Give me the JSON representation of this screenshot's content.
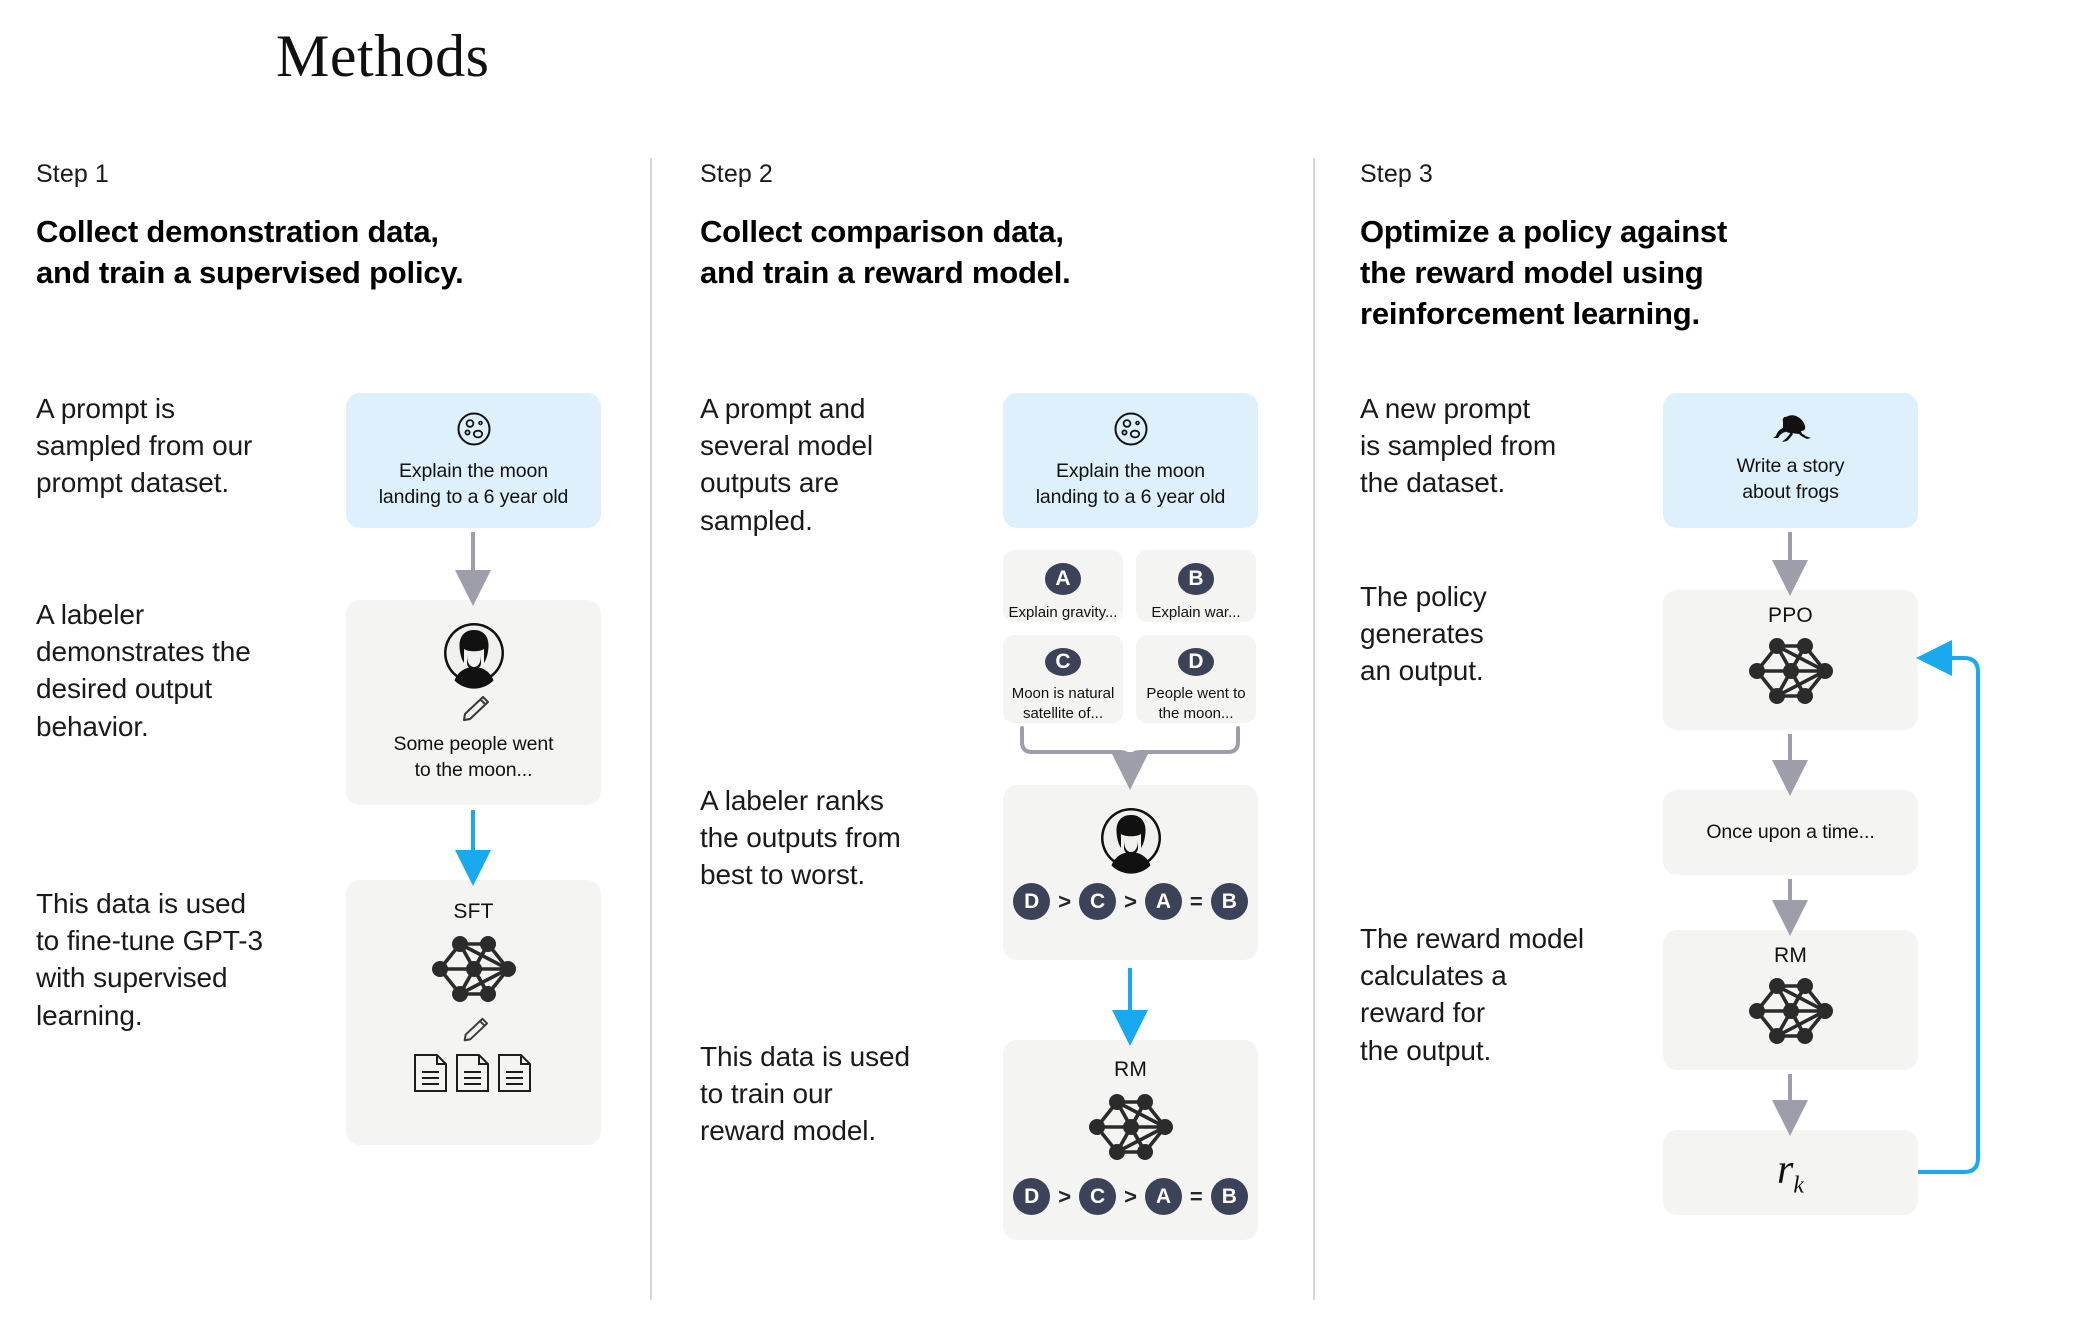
{
  "title": "Methods",
  "colors": {
    "prompt_box_bg": "#ddf0fb",
    "neutral_box_bg": "#f4f4f2",
    "gray_arrow": "#9e9eaa",
    "blue_arrow": "#19a9ef",
    "badge_bg": "#3c4257",
    "divider": "#d6d6d6"
  },
  "columns": [
    {
      "step_label": "Step 1",
      "step_title": "Collect demonstration data,\nand train a supervised policy.",
      "captions": [
        "A prompt is\nsampled from our\nprompt dataset.",
        "A labeler\ndemonstrates the\ndesired output\nbehavior.",
        "This data is used\nto fine-tune GPT-3\nwith supervised\nlearning."
      ],
      "nodes": {
        "prompt": {
          "icon": "moon-icon",
          "text": "Explain the moon\nlanding to a 6 year old"
        },
        "labeler": {
          "icon": "labeler-avatar-icon",
          "sub_icon": "pencil-icon",
          "text": "Some people went\nto the moon..."
        },
        "model": {
          "title": "SFT",
          "icon": "neural-network-icon",
          "sub_icon": "pencil-icon",
          "docs_icon": "documents-icon"
        }
      }
    },
    {
      "step_label": "Step 2",
      "step_title": "Collect comparison data,\nand train a reward model.",
      "captions": [
        "A prompt and\nseveral model\noutputs are\nsampled.",
        "A labeler ranks\nthe outputs from\nbest to worst.",
        "This data is used\nto train our\nreward model."
      ],
      "nodes": {
        "prompt": {
          "icon": "moon-icon",
          "text": "Explain the moon\nlanding to a 6 year old"
        },
        "outputs": [
          {
            "letter": "A",
            "text": "Explain gravity..."
          },
          {
            "letter": "B",
            "text": "Explain war..."
          },
          {
            "letter": "C",
            "text": "Moon is natural\nsatellite of..."
          },
          {
            "letter": "D",
            "text": "People went to\nthe moon..."
          }
        ],
        "ranking": {
          "icon": "labeler-avatar-icon",
          "order": [
            "D",
            ">",
            "C",
            ">",
            "A",
            "=",
            "B"
          ]
        },
        "reward_model": {
          "title": "RM",
          "icon": "neural-network-icon",
          "order": [
            "D",
            ">",
            "C",
            ">",
            "A",
            "=",
            "B"
          ]
        }
      }
    },
    {
      "step_label": "Step 3",
      "step_title": "Optimize a policy against\nthe reward model using\nreinforcement learning.",
      "captions": [
        "A new prompt\nis sampled from\nthe dataset.",
        "The policy\ngenerates\nan output.",
        "The reward model\ncalculates a\nreward for\nthe output."
      ],
      "nodes": {
        "prompt": {
          "icon": "frog-icon",
          "text": "Write a story\nabout frogs"
        },
        "policy": {
          "title": "PPO",
          "icon": "neural-network-icon"
        },
        "output": {
          "text": "Once upon a time..."
        },
        "reward_model": {
          "title": "RM",
          "icon": "neural-network-icon"
        },
        "reward": {
          "symbol": "r",
          "subscript": "k"
        }
      }
    }
  ]
}
